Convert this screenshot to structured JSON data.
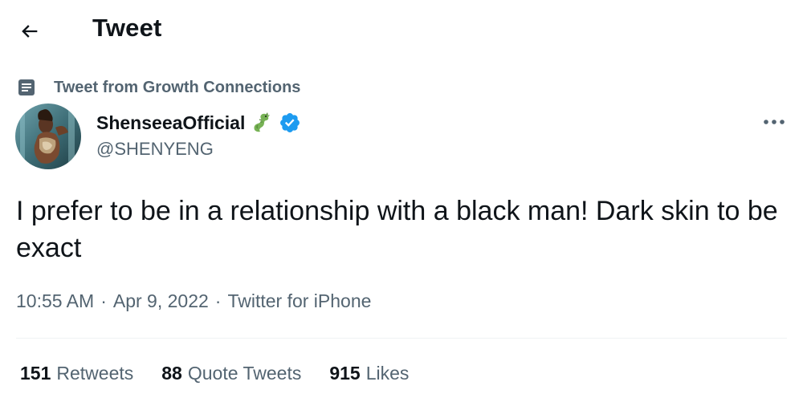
{
  "header": {
    "title": "Tweet",
    "back_icon": "arrow-left-icon"
  },
  "social_context": {
    "icon": "list-icon",
    "text": "Tweet from Growth Connections"
  },
  "author": {
    "name": "ShenseeaOfficial",
    "handle": "@SHENYENG",
    "emoji_icon": "dragon-icon",
    "verified": true,
    "verified_color": "#1d9bf0"
  },
  "tweet": {
    "text": "I prefer to be in a relationship with a black man! Dark skin to be exact",
    "time": "10:55 AM",
    "date": "Apr 9, 2022",
    "source": "Twitter for iPhone",
    "separator": "·"
  },
  "stats": {
    "retweets": {
      "count": "151",
      "label": "Retweets"
    },
    "quotes": {
      "count": "88",
      "label": "Quote Tweets"
    },
    "likes": {
      "count": "915",
      "label": "Likes"
    }
  },
  "colors": {
    "text_primary": "#0f1419",
    "text_secondary": "#536471",
    "divider": "#eff3f4"
  }
}
